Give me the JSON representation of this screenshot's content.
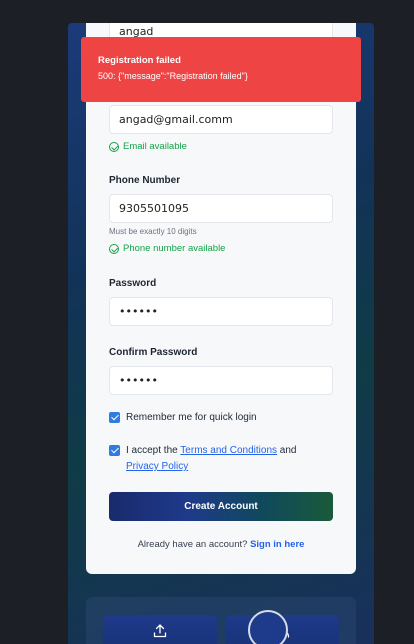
{
  "form": {
    "name_value": "angad",
    "email_value": "angad@gmail.comm",
    "email_status": "Email available",
    "phone_label": "Phone Number",
    "phone_value": "9305501095",
    "phone_hint": "Must be exactly 10 digits",
    "phone_status": "Phone number available",
    "password_label": "Password",
    "password_value": "••••••",
    "confirm_label": "Confirm Password",
    "confirm_value": "••••••",
    "remember_label": "Remember me for quick login",
    "terms_prefix": "I accept the ",
    "terms_link": "Terms and Conditions",
    "terms_and": " and",
    "privacy_link": "Privacy Policy",
    "submit_label": "Create Account",
    "signin_prefix": "Already have an account? ",
    "signin_link": "Sign in here"
  },
  "toast": {
    "title": "Registration failed",
    "message": "500: {\"message\":\"Registration failed\"}"
  },
  "icons": {
    "upload": "upload-icon",
    "users": "users-icon"
  },
  "colors": {
    "toast": "#ef4444",
    "success": "#16a34a",
    "link": "#2563eb",
    "checkbox": "#2f7be0"
  }
}
